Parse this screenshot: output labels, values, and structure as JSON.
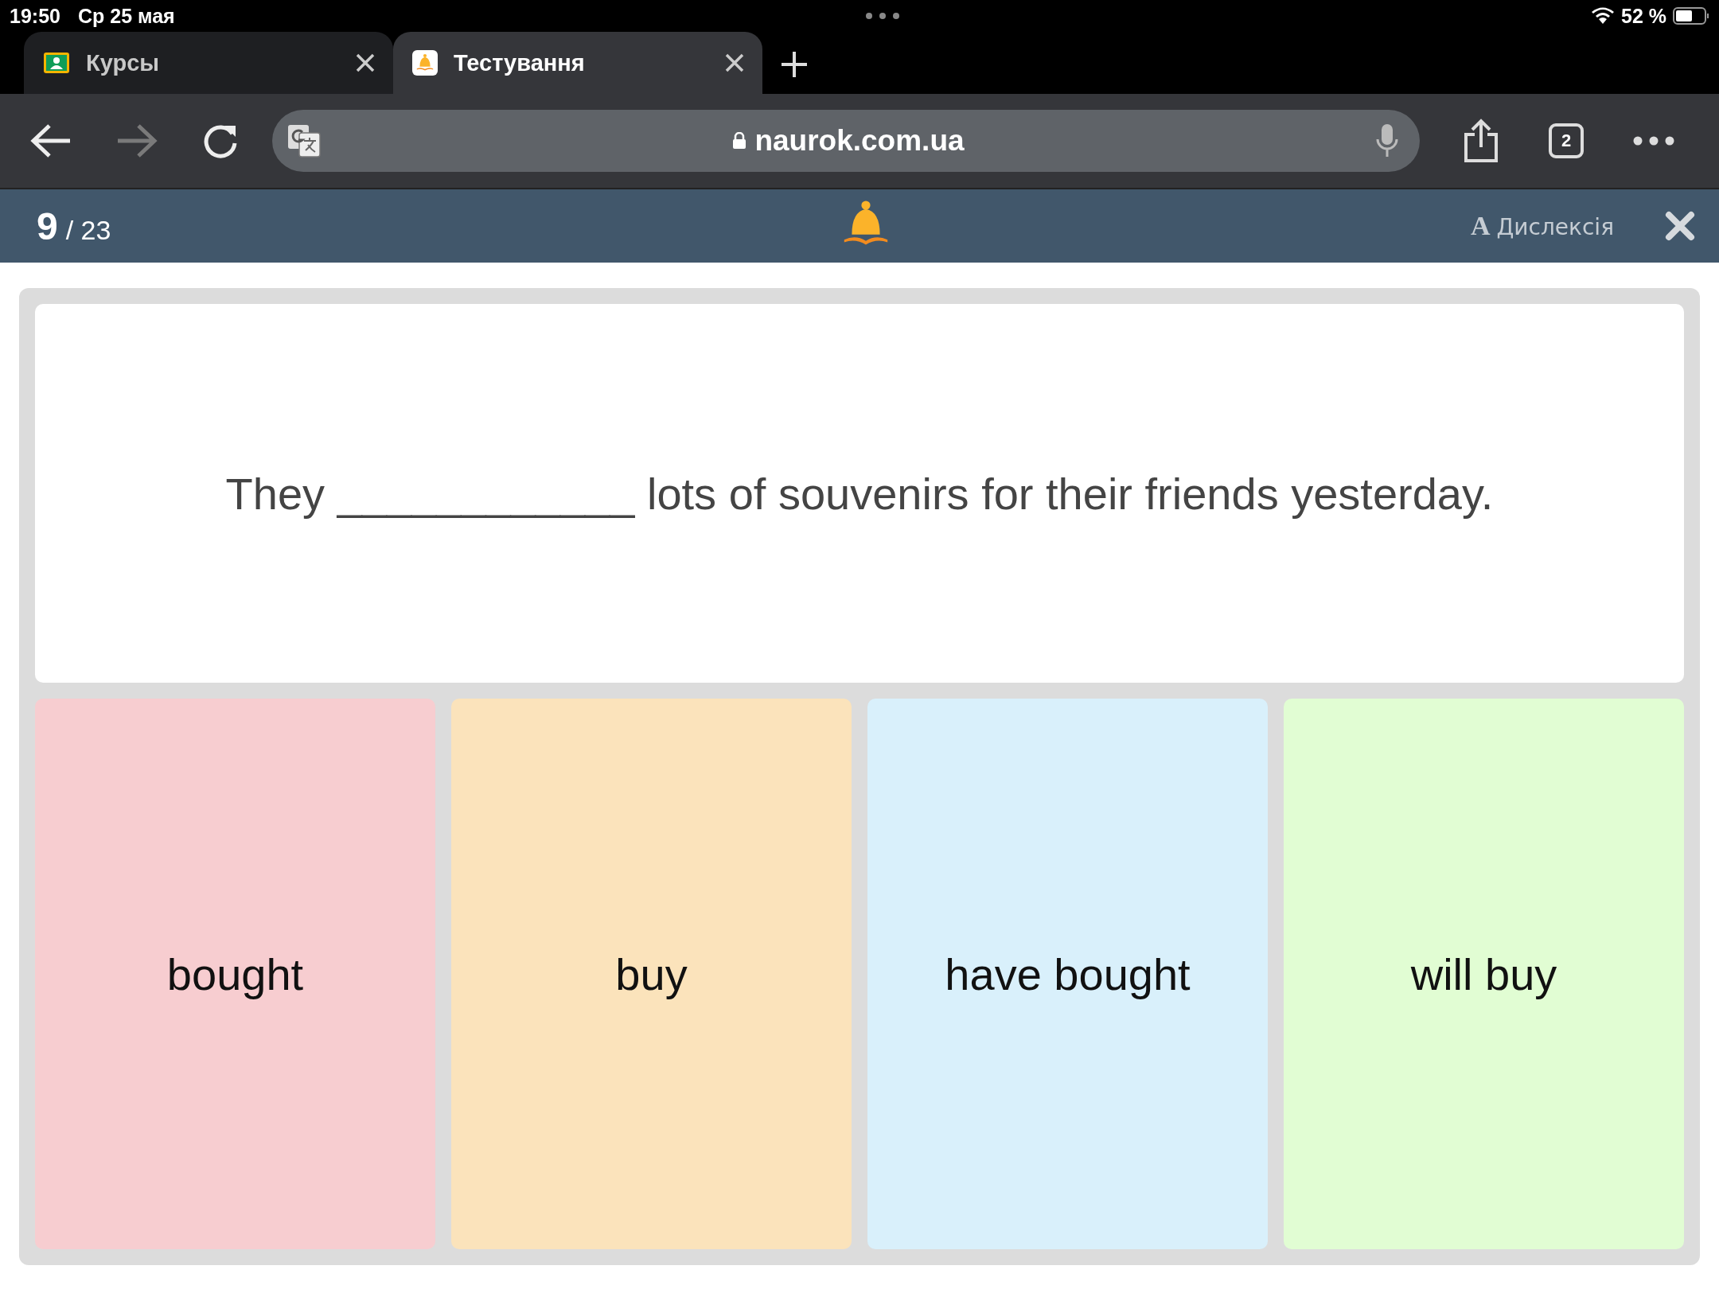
{
  "status_bar": {
    "time": "19:50",
    "date": "Ср 25 мая",
    "battery": "52 %"
  },
  "tabs": [
    {
      "title": "Курсы",
      "kind": "courses",
      "selected": false
    },
    {
      "title": "Тестування",
      "kind": "bell",
      "selected": true
    }
  ],
  "address_bar": {
    "url": "naurok.com.ua"
  },
  "tab_count": "2",
  "quiz_header": {
    "current": "9",
    "total": "/ 23",
    "dyslexia_icon": "A",
    "dyslexia_label": "Дислексія"
  },
  "question": {
    "text": "They ____________ lots of souvenirs for their friends yesterday."
  },
  "answers": [
    {
      "text": "bought",
      "color": "#f7cdd0"
    },
    {
      "text": "buy",
      "color": "#fbe3bb"
    },
    {
      "text": "have bought",
      "color": "#d9f0fb"
    },
    {
      "text": "will buy",
      "color": "#e1fdd3"
    }
  ]
}
